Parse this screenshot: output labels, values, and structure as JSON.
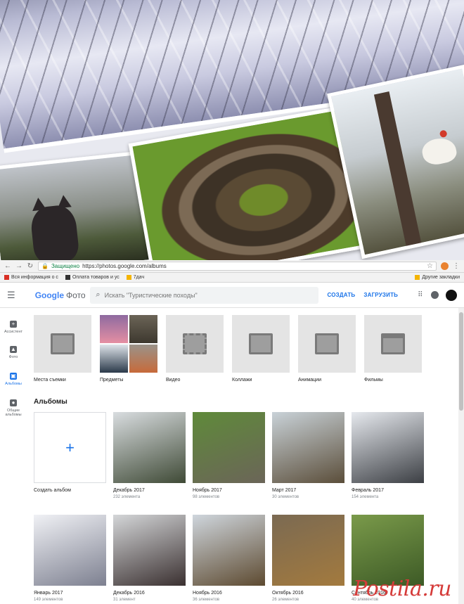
{
  "browser": {
    "back_icon": "arrow-left-icon",
    "secure_label": "Защищено",
    "url": "https://photos.google.com/albums"
  },
  "bookmarks": [
    {
      "label": "Вся информация о с",
      "color": "#d93025"
    },
    {
      "label": "Оплата товаров и ус",
      "color": "#333333"
    },
    {
      "label": "7дач",
      "color": "#f4b400"
    }
  ],
  "bookmarks_other": "Другие закладки",
  "header": {
    "logo_google": "Google",
    "logo_product": "Фото",
    "search_placeholder": "Искать \"Туристические походы\"",
    "create_label": "СОЗДАТЬ",
    "upload_label": "ЗАГРУЗИТЬ"
  },
  "rail": [
    {
      "label": "Ассистент",
      "icon": "plus-box-icon",
      "active": false
    },
    {
      "label": "Фото",
      "icon": "photo-icon",
      "active": false
    },
    {
      "label": "Альбомы",
      "icon": "album-icon",
      "active": true
    },
    {
      "label": "Общие альбомы",
      "icon": "people-icon",
      "active": false
    }
  ],
  "categories": [
    {
      "label": "Места съемки",
      "icon": "places-icon"
    },
    {
      "label": "Предметы",
      "icon": "things-collage"
    },
    {
      "label": "Видео",
      "icon": "video-icon"
    },
    {
      "label": "Коллажи",
      "icon": "collage-icon"
    },
    {
      "label": "Анимации",
      "icon": "animation-icon"
    },
    {
      "label": "Фильмы",
      "icon": "movie-icon"
    }
  ],
  "albums_title": "Альбомы",
  "create_album_label": "Создать альбом",
  "albums": [
    {
      "title": "Декабрь 2017",
      "count": "232 элемента",
      "colors": [
        "#d9dde0",
        "#3f4a36"
      ]
    },
    {
      "title": "Ноябрь 2017",
      "count": "98 элементов",
      "colors": [
        "#5f8a3a",
        "#6b6558"
      ]
    },
    {
      "title": "Март 2017",
      "count": "30 элементов",
      "colors": [
        "#c9d2d8",
        "#5b4e3a"
      ]
    },
    {
      "title": "Февраль 2017",
      "count": "154 элемента",
      "colors": [
        "#e6e9ee",
        "#3c3f44"
      ]
    },
    {
      "title": "Январь 2017",
      "count": "149 элементов",
      "colors": [
        "#f0f1f5",
        "#7d8090"
      ]
    },
    {
      "title": "Декабрь 2016",
      "count": "31 элемент",
      "colors": [
        "#d4d6d8",
        "#3a3030"
      ]
    },
    {
      "title": "Ноябрь 2016",
      "count": "36 элементов",
      "colors": [
        "#cfd6dd",
        "#5d4a30"
      ]
    },
    {
      "title": "Октябрь 2016",
      "count": "26 элементов",
      "colors": [
        "#7b6a52",
        "#a37a3e"
      ]
    },
    {
      "title": "Сентябрь 2016",
      "count": "40 элементов",
      "colors": [
        "#7a9a4a",
        "#3d5a26"
      ]
    }
  ],
  "watermark": "Postila.ru"
}
